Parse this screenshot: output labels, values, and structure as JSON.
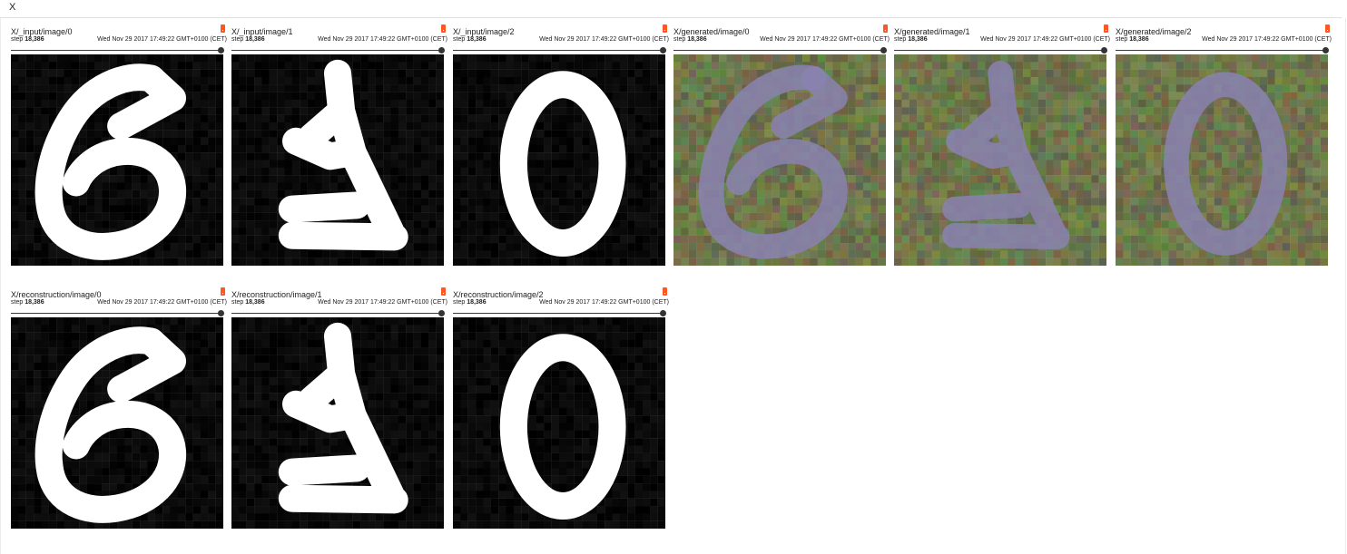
{
  "group": {
    "title": "X"
  },
  "cards": [
    {
      "title": "X/_input/image/0",
      "step_label": "step",
      "step_value": "18,386",
      "date": "Wed Nov 29 2017 17:49:22 GMT+0100 (CET)",
      "digit": "6",
      "style": "input"
    },
    {
      "title": "X/_input/image/1",
      "step_label": "step",
      "step_value": "18,386",
      "date": "Wed Nov 29 2017 17:49:22 GMT+0100 (CET)",
      "digit": "4",
      "style": "input"
    },
    {
      "title": "X/_input/image/2",
      "step_label": "step",
      "step_value": "18,386",
      "date": "Wed Nov 29 2017 17:49:22 GMT+0100 (CET)",
      "digit": "0",
      "style": "input"
    },
    {
      "title": "X/generated/image/0",
      "step_label": "step",
      "step_value": "18,386",
      "date": "Wed Nov 29 2017 17:49:22 GMT+0100 (CET)",
      "digit": "6",
      "style": "generated"
    },
    {
      "title": "X/generated/image/1",
      "step_label": "step",
      "step_value": "18,386",
      "date": "Wed Nov 29 2017 17:49:22 GMT+0100 (CET)",
      "digit": "4",
      "style": "generated"
    },
    {
      "title": "X/generated/image/2",
      "step_label": "step",
      "step_value": "18,386",
      "date": "Wed Nov 29 2017 17:49:22 GMT+0100 (CET)",
      "digit": "0",
      "style": "generated"
    },
    {
      "title": "X/reconstruction/image/0",
      "step_label": "step",
      "step_value": "18,386",
      "date": "Wed Nov 29 2017 17:49:22 GMT+0100 (CET)",
      "digit": "6",
      "style": "input"
    },
    {
      "title": "X/reconstruction/image/1",
      "step_label": "step",
      "step_value": "18,386",
      "date": "Wed Nov 29 2017 17:49:22 GMT+0100 (CET)",
      "digit": "4",
      "style": "input"
    },
    {
      "title": "X/reconstruction/image/2",
      "step_label": "step",
      "step_value": "18,386",
      "date": "Wed Nov 29 2017 17:49:22 GMT+0100 (CET)",
      "digit": "0",
      "style": "input"
    }
  ],
  "slider_position": 1.0,
  "colors": {
    "pin": "#ff5722",
    "input_bg": "#000000",
    "input_fg": "#ffffff",
    "generated_bg": "#6f7d52",
    "generated_fg": "#8a83b0"
  }
}
